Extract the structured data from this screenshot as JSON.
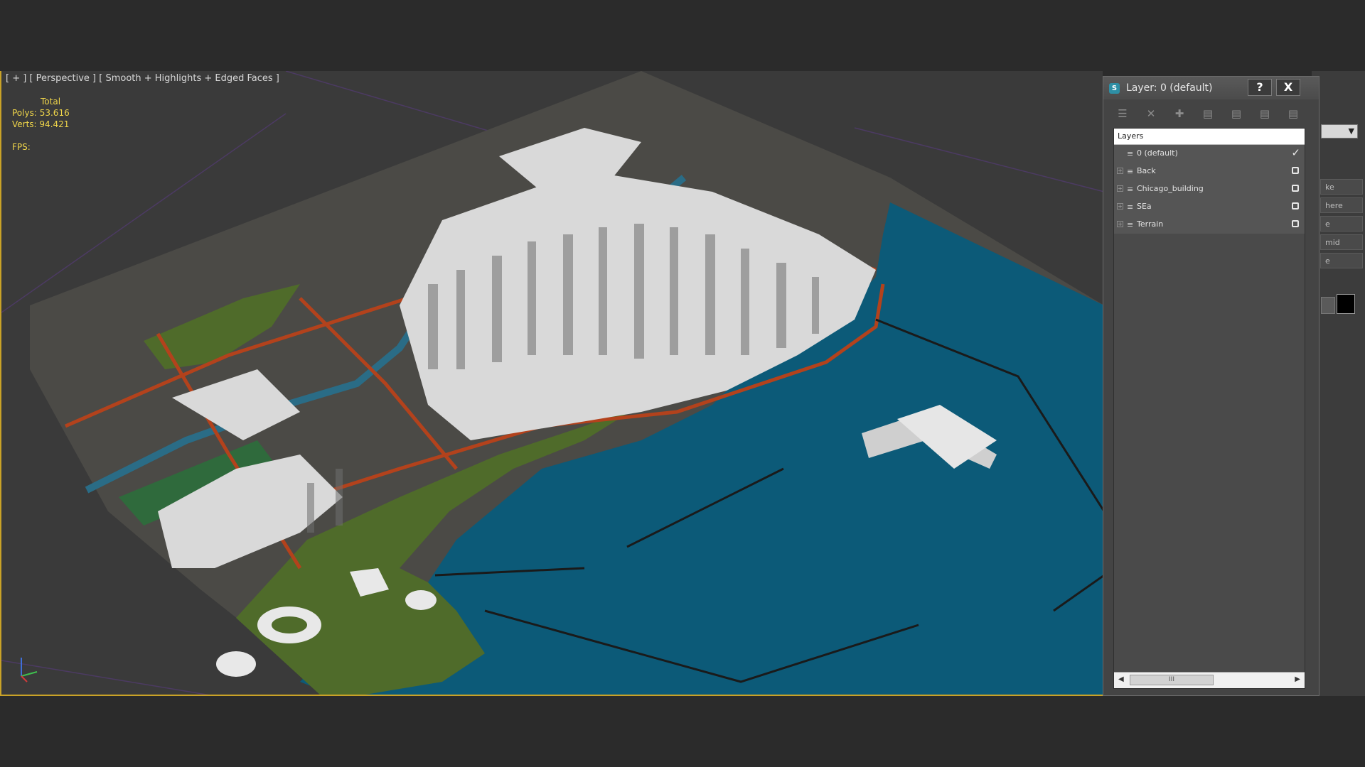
{
  "viewport": {
    "label": "[ + ] [ Perspective ] [ Smooth + Highlights + Edged Faces ]",
    "stats": {
      "header": "Total",
      "polys_label": "Polys:",
      "polys_value": "53.616",
      "verts_label": "Verts:",
      "verts_value": "94.421",
      "fps_label": "FPS:"
    },
    "axis": {
      "x": "x",
      "y": "y",
      "z": "z"
    }
  },
  "command_panel": {
    "buttons": [
      "ke",
      "here",
      "e",
      "mid",
      "e"
    ]
  },
  "layer_dialog": {
    "title": "Layer: 0 (default)",
    "help_label": "?",
    "close_label": "X",
    "list_header": "Layers",
    "layers": [
      {
        "name": "0 (default)",
        "active": true
      },
      {
        "name": "Back",
        "active": false
      },
      {
        "name": "Chicago_building",
        "active": false
      },
      {
        "name": "SEa",
        "active": false
      },
      {
        "name": "Terrain",
        "active": false
      }
    ],
    "scroll_thumb": "III"
  },
  "colors": {
    "sea": "#0c5a78",
    "park": "#4f6b2a",
    "building": "#d9d9d9",
    "road": "#b3421c",
    "stats_text": "#f0d64a"
  }
}
